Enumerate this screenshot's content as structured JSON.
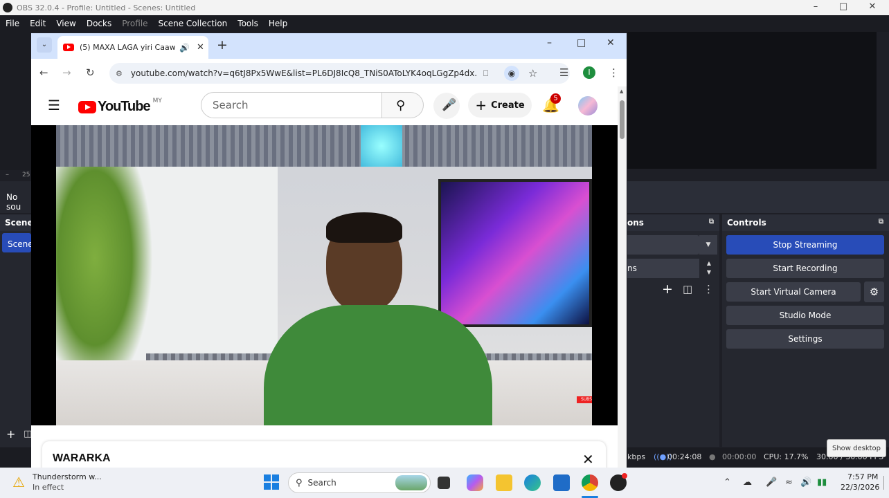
{
  "obs": {
    "title": "OBS 32.0.4 - Profile: Untitled - Scenes: Untitled",
    "menu": [
      "File",
      "Edit",
      "View",
      "Docks",
      "Profile",
      "Scene Collection",
      "Tools",
      "Help"
    ],
    "volume_partial": "25",
    "no_source_partial": "No sou",
    "scenes_partial": "Scene",
    "scene_item_partial": "Scene",
    "transitions_partial": "ons",
    "transition_row2_partial": "ns",
    "controls_title": "Controls",
    "controls": {
      "stop_streaming": "Stop Streaming",
      "start_recording": "Start Recording",
      "start_virtual_camera": "Start Virtual Camera",
      "studio_mode": "Studio Mode",
      "settings": "Settings"
    },
    "status": {
      "kbps_partial": "kbps",
      "stream_time": "00:24:08",
      "rec_time": "00:00:00",
      "cpu": "CPU: 17.7%",
      "fps_partial": "30.00 / 30.00 FPS"
    },
    "show_desktop": "Show desktop"
  },
  "chrome": {
    "tab_title": "(5) MAXA LAGA yiri Caawa",
    "url": "youtube.com/watch?v=q6tJ8Px5WwE&list=PL6DJ8IcQ8_TNiS0AToLYK4oqLGgZp4dx...",
    "profile_initial": "I"
  },
  "youtube": {
    "logo_text": "YouTube",
    "region": "MY",
    "search_placeholder": "Search",
    "create_label": "Create",
    "notifications_count": "5",
    "subscribe_partial": "SUBSCRIBE",
    "panel_title": "WARARKA"
  },
  "taskbar": {
    "weather_title": "Thunderstorm w...",
    "weather_sub": "In effect",
    "search_label": "Search",
    "time": "7:57 PM",
    "date": "22/3/2026"
  }
}
